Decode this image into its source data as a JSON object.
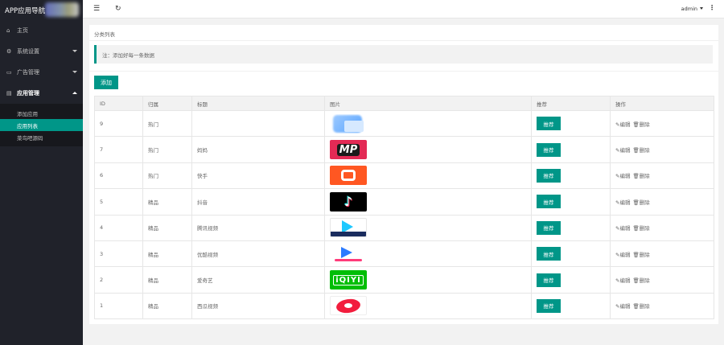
{
  "brand": {
    "title": "APP应用导航"
  },
  "sidebar": {
    "items": [
      {
        "label": "主页",
        "icon": "home-icon"
      },
      {
        "label": "系统设置",
        "icon": "gear-icon"
      },
      {
        "label": "广告管理",
        "icon": "ad-icon"
      },
      {
        "label": "应用管理",
        "icon": "app-icon"
      }
    ],
    "subitems": [
      {
        "label": "添加应用"
      },
      {
        "label": "应用列表"
      },
      {
        "label": "菜鸟吧源码"
      }
    ]
  },
  "header": {
    "menu_icon": "☰",
    "refresh_icon": "↻",
    "user": "admin",
    "more_icon": "⋮"
  },
  "breadcrumb": "分类列表",
  "note": "注：添加好每一条数据",
  "add_button": "添加",
  "table": {
    "columns": [
      "ID",
      "归属",
      "标题",
      "图片",
      "推荐",
      "操作"
    ],
    "rows": [
      {
        "id": "9",
        "group": "热门",
        "title": "",
        "logo": "blurred"
      },
      {
        "id": "7",
        "group": "热门",
        "title": "妈妈",
        "logo": "mp"
      },
      {
        "id": "6",
        "group": "热门",
        "title": "快手",
        "logo": "kuaishou"
      },
      {
        "id": "5",
        "group": "精品",
        "title": "抖音",
        "logo": "tiktok"
      },
      {
        "id": "4",
        "group": "精品",
        "title": "腾讯视频",
        "logo": "tencent-video"
      },
      {
        "id": "3",
        "group": "精品",
        "title": "优酷视频",
        "logo": "youku"
      },
      {
        "id": "2",
        "group": "精品",
        "title": "爱奇艺",
        "logo": "iqiyi"
      },
      {
        "id": "1",
        "group": "精品",
        "title": "西瓜视频",
        "logo": "xigua"
      }
    ],
    "recommend_label": "推荐",
    "edit_label": "编辑",
    "delete_label": "删除",
    "mp_text": "MP",
    "iqiyi_text": "iQIYI",
    "tiktok_text": "♪"
  },
  "colors": {
    "accent": "#009688",
    "sidebar": "#20222a"
  }
}
